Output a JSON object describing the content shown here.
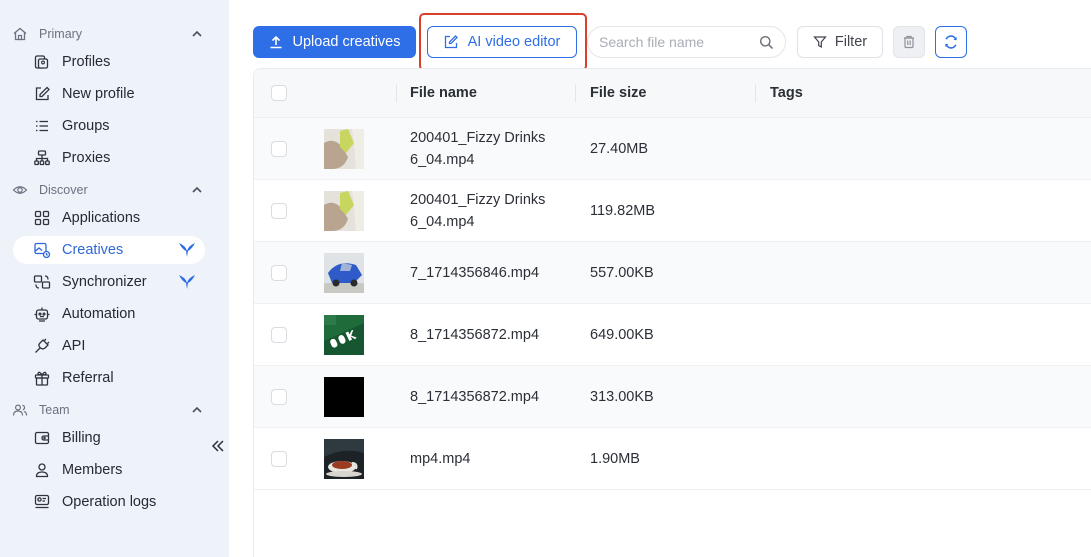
{
  "sidebar": {
    "sections": [
      {
        "label": "Primary",
        "items": [
          "Profiles",
          "New profile",
          "Groups",
          "Proxies"
        ]
      },
      {
        "label": "Discover",
        "items": [
          "Applications",
          "Creatives",
          "Synchronizer",
          "Automation",
          "API",
          "Referral"
        ]
      },
      {
        "label": "Team",
        "items": [
          "Billing",
          "Members",
          "Operation logs"
        ]
      }
    ],
    "active_item": "Creatives",
    "accent_color": "#2e6ee6"
  },
  "toolbar": {
    "upload_label": "Upload creatives",
    "ai_editor_label": "AI video editor",
    "search_placeholder": "Search file name",
    "filter_label": "Filter"
  },
  "table": {
    "headers": [
      "File name",
      "File size",
      "Tags"
    ],
    "rows": [
      {
        "name_line1": "200401_Fizzy Drinks",
        "name_line2": "6_04.mp4",
        "size": "27.40MB",
        "thumb": "hand-bottle-green"
      },
      {
        "name_line1": "200401_Fizzy Drinks",
        "name_line2": "6_04.mp4",
        "size": "119.82MB",
        "thumb": "hand-bottle-green"
      },
      {
        "name_line1": "7_1714356846.mp4",
        "name_line2": "",
        "size": "557.00KB",
        "thumb": "blue-car"
      },
      {
        "name_line1": "8_1714356872.mp4",
        "name_line2": "",
        "size": "649.00KB",
        "thumb": "green-sign"
      },
      {
        "name_line1": "8_1714356872.mp4",
        "name_line2": "",
        "size": "313.00KB",
        "thumb": "black-frame"
      },
      {
        "name_line1": "mp4.mp4",
        "name_line2": "",
        "size": "1.90MB",
        "thumb": "tea-cup"
      }
    ]
  }
}
